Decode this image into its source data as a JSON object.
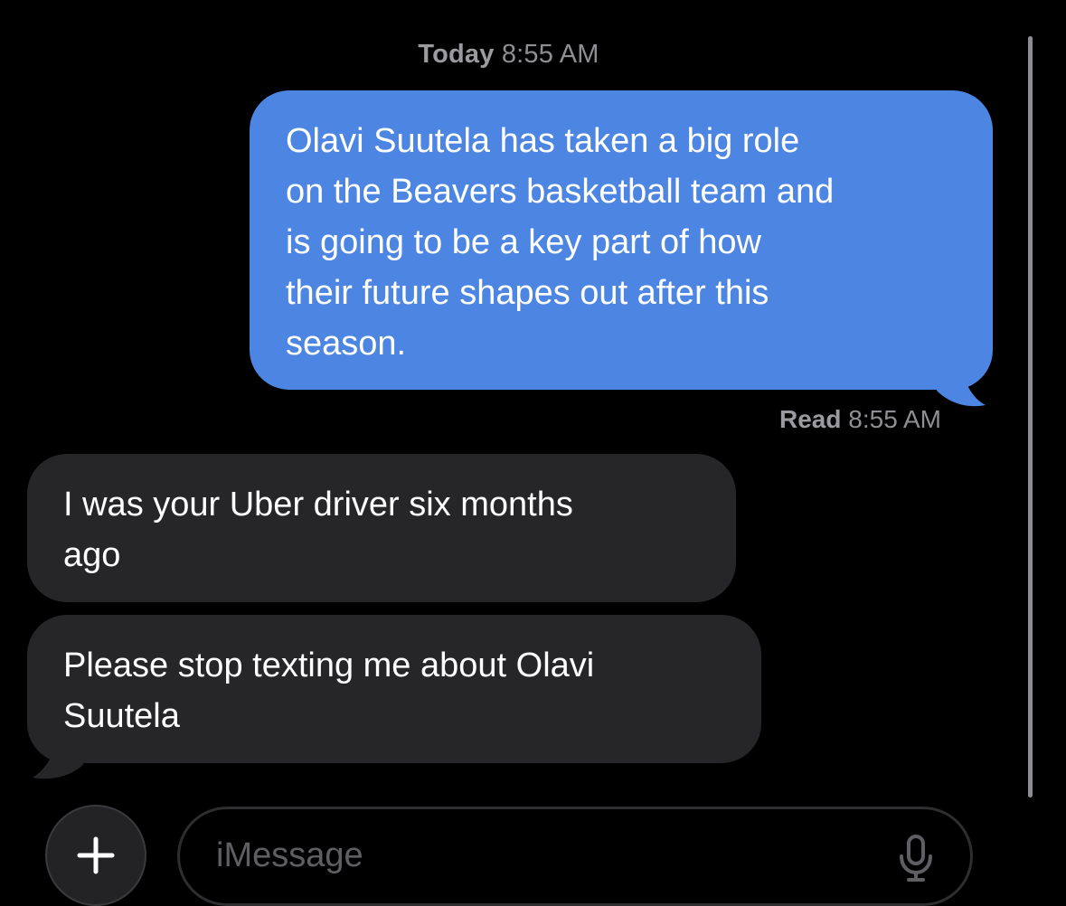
{
  "header": {
    "day": "Today",
    "time": "8:55 AM"
  },
  "messages": [
    {
      "direction": "outgoing",
      "lines": [
        "Olavi Suutela has taken a big role",
        "on the Beavers basketball team and",
        "is going to be a key part of how",
        "their future shapes out after this",
        "season."
      ]
    },
    {
      "direction": "incoming",
      "lines": [
        "I was your Uber driver six months",
        "ago"
      ]
    },
    {
      "direction": "incoming",
      "lines": [
        "Please stop texting me about Olavi",
        "Suutela"
      ]
    }
  ],
  "read_receipt": {
    "label": "Read",
    "time": "8:55 AM"
  },
  "composer": {
    "add_symbol": "+",
    "placeholder": "iMessage",
    "add_icon": "plus-icon",
    "dictation_icon": "microphone-icon"
  },
  "colors": {
    "background": "#000000",
    "outgoing_bubble": "#4d86e2",
    "incoming_bubble": "#262629",
    "secondary_text": "#8e8e93"
  }
}
